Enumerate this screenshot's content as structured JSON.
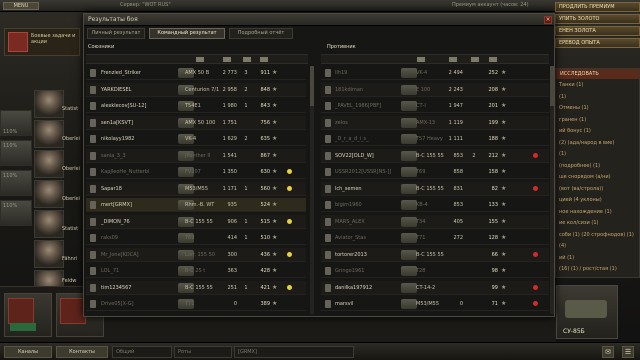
{
  "topbar": {
    "menu_label": "MENU",
    "server": "Сервер: \"WOT RUS\"",
    "account": "Премиум аккаунт (часов: 24)"
  },
  "left_panel": {
    "promo_text": "Боевые задачи и акции",
    "side_numbers": [
      "110%",
      "110%",
      "110%",
      "110%"
    ],
    "side_words": [
      "Statist",
      "Oberlei",
      "Oberlei",
      "Oberlei",
      "Statist",
      "Fähnri",
      "Feldw"
    ]
  },
  "right_panel": {
    "buttons": [
      "ПРОДЛИТЬ ПРЕМИУМ",
      "УПИТЬ ЗОЛОТО",
      "ЕНЕН ЗОЛОТА",
      "ЕРЕВОД ОПЫТА"
    ],
    "list_header": "ИССЛЕДОВАТЬ",
    "list_items": [
      "Танки (1)",
      "(1)",
      "Отмены (1)",
      "гранен (1)",
      "ий бонус (1)",
      "(2) (ада/народ в вие)",
      "(1)",
      "(подробнее) (1)",
      "ше снорядом (а/ни)",
      "(вот (ва/строла))",
      "цией (4 уклоны)",
      "ное нахождение (1)",
      "ие кол/сизи (1)",
      "соби (1) (20 строфнодов) (1)",
      "(4)",
      "ий (1)",
      "(16) (1) / рост/стая (1)"
    ],
    "vehicle_name": "СУ-85Б"
  },
  "modal": {
    "title": "Результаты боя",
    "tabs": [
      "Личный результат",
      "Командный результат",
      "Подробный отчёт"
    ],
    "allies_header": "Союзники",
    "enemies_header": "Противник"
  },
  "allies": [
    {
      "name": "Frenzied_Striker",
      "tank": "AMX 50 B",
      "dmg": "2 773",
      "frags": "3",
      "xp": "911",
      "state": "alive",
      "dot": ""
    },
    {
      "name": "YARKDIESEL",
      "tank": "Centurion 7/1",
      "dmg": "2 958",
      "frags": "2",
      "xp": "848",
      "state": "alive",
      "dot": ""
    },
    {
      "name": "alexklecov[SU-12]",
      "tank": "T54E1",
      "dmg": "1 980",
      "frags": "1",
      "xp": "843",
      "state": "alive",
      "dot": ""
    },
    {
      "name": "sen1a[KSVT]",
      "tank": "AMX 50 100",
      "dmg": "1 751",
      "frags": "",
      "xp": "756",
      "state": "alive",
      "dot": ""
    },
    {
      "name": "nikolayy1982",
      "tank": "VK-4",
      "dmg": "1 629",
      "frags": "2",
      "xp": "635",
      "state": "alive",
      "dot": ""
    },
    {
      "name": "sania_3_3",
      "tank": "JPanther II",
      "dmg": "1 541",
      "frags": "",
      "xp": "867",
      "state": "dead",
      "dot": ""
    },
    {
      "name": "KapJleoHe_Nutterbl",
      "tank": "FV207",
      "dmg": "1 350",
      "frags": "",
      "xp": "630",
      "state": "dead",
      "dot": "#e6d23a"
    },
    {
      "name": "Sapar18",
      "tank": "M53/M55",
      "dmg": "1 171",
      "frags": "1",
      "xp": "560",
      "state": "alive",
      "dot": "#e6d23a"
    },
    {
      "name": "mert[GRMX]",
      "tank": "Rhm.-B. WT",
      "dmg": "935",
      "frags": "",
      "xp": "524",
      "state": "me",
      "dot": ""
    },
    {
      "name": "_DIMON_76",
      "tank": "B-C 155 55",
      "dmg": "906",
      "frags": "1",
      "xp": "515",
      "state": "alive",
      "dot": "#e6d23a"
    },
    {
      "name": "raks09",
      "tank": "T69",
      "dmg": "414",
      "frags": "1",
      "xp": "510",
      "state": "dead",
      "dot": ""
    },
    {
      "name": "Mr_Jone[KDCA]",
      "tank": "Lorr. 155 50",
      "dmg": "300",
      "frags": "",
      "xp": "436",
      "state": "dead",
      "dot": "#e6d23a"
    },
    {
      "name": "LOL_71",
      "tank": "B-C 25 t",
      "dmg": "363",
      "frags": "",
      "xp": "428",
      "state": "dead",
      "dot": ""
    },
    {
      "name": "tim1234567",
      "tank": "B-C 155 55",
      "dmg": "251",
      "frags": "1",
      "xp": "421",
      "state": "alive",
      "dot": "#e6d23a"
    },
    {
      "name": "Drive05[X-G]",
      "tank": "T71",
      "dmg": "0",
      "frags": "",
      "xp": "389",
      "state": "dead",
      "dot": ""
    }
  ],
  "enemies": [
    {
      "name": "llh19",
      "tank": "VK-4",
      "dmg": "2 494",
      "frags": "",
      "xp": "252",
      "state": "dead",
      "dot": ""
    },
    {
      "name": "181kdiman",
      "tank": "E 100",
      "dmg": "2 243",
      "frags": "",
      "xp": "208",
      "state": "dead",
      "dot": ""
    },
    {
      "name": "_PAVEL_1986[PBF]",
      "tank": "СТ-I",
      "dmg": "1 947",
      "frags": "",
      "xp": "201",
      "state": "dead",
      "dot": ""
    },
    {
      "name": "zelos",
      "tank": "AMX-13",
      "dmg": "1 119",
      "frags": "",
      "xp": "199",
      "state": "dead",
      "dot": ""
    },
    {
      "name": "_D_r_a_d_i_s_",
      "tank": "T57 Heavy",
      "dmg": "1 111",
      "frags": "",
      "xp": "188",
      "state": "dead",
      "dot": ""
    },
    {
      "name": "SOV22[OLD_W]",
      "tank": "B-C 155 55",
      "dmg": "853",
      "frags": "2",
      "xp": "212",
      "state": "alive",
      "dot": "#d32a2a"
    },
    {
      "name": "USSR2012[USSR[NS-]]",
      "tank": "T69",
      "dmg": "858",
      "frags": "",
      "xp": "158",
      "state": "dead",
      "dot": ""
    },
    {
      "name": "lch_semen",
      "tank": "B-C 155 55",
      "dmg": "831",
      "frags": "",
      "xp": "82",
      "state": "alive",
      "dot": "#d32a2a"
    },
    {
      "name": "bigim1960",
      "tank": "KB-4",
      "dmg": "853",
      "frags": "",
      "xp": "133",
      "state": "dead",
      "dot": ""
    },
    {
      "name": "MARS_ALEX",
      "tank": "T34",
      "dmg": "405",
      "frags": "",
      "xp": "155",
      "state": "dead",
      "dot": ""
    },
    {
      "name": "Aviator_Stas",
      "tank": "T71",
      "dmg": "272",
      "frags": "",
      "xp": "128",
      "state": "dead",
      "dot": ""
    },
    {
      "name": "tortorer2013",
      "tank": "B-C 155 55",
      "dmg": "",
      "frags": "",
      "xp": "66",
      "state": "alive",
      "dot": "#d32a2a"
    },
    {
      "name": "Gringo1961",
      "tank": "T28",
      "dmg": "",
      "frags": "",
      "xp": "98",
      "state": "dead",
      "dot": ""
    },
    {
      "name": "danilka197912",
      "tank": "CT-14-2",
      "dmg": "",
      "frags": "",
      "xp": "99",
      "state": "alive",
      "dot": "#d32a2a"
    },
    {
      "name": "marsvil",
      "tank": "M53/M55",
      "dmg": "0",
      "frags": "",
      "xp": "71",
      "state": "alive",
      "dot": "#d32a2a"
    }
  ],
  "bottombar": {
    "channels": "Каналы",
    "contacts": "Контакты",
    "field1": "Общий",
    "field2": "Роты",
    "field3": "[GRMX]"
  }
}
